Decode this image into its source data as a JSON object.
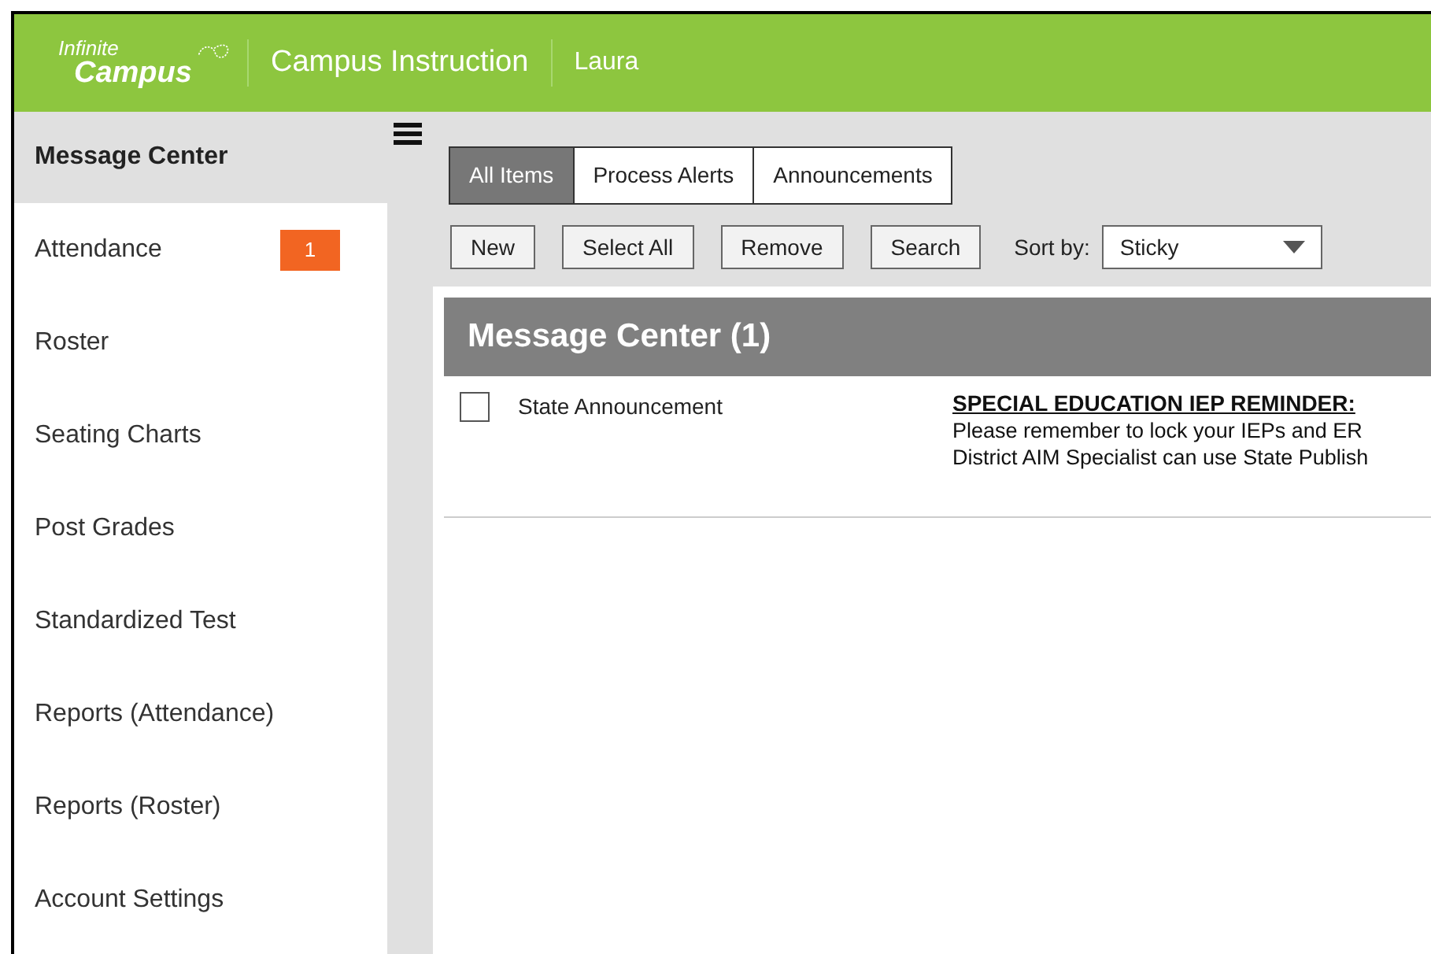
{
  "header": {
    "logo": [
      "Infinite",
      "Campus"
    ],
    "app_title": "Campus Instruction",
    "user": "Laura"
  },
  "sidebar": {
    "title": "Message Center",
    "items": [
      {
        "label": "Attendance",
        "badge": "1"
      },
      {
        "label": "Roster"
      },
      {
        "label": "Seating Charts"
      },
      {
        "label": "Post Grades"
      },
      {
        "label": "Standardized Test"
      },
      {
        "label": "Reports (Attendance)"
      },
      {
        "label": "Reports (Roster)"
      },
      {
        "label": "Account Settings"
      }
    ]
  },
  "tabs": [
    {
      "label": "All Items",
      "selected": true
    },
    {
      "label": "Process Alerts",
      "selected": false
    },
    {
      "label": "Announcements",
      "selected": false
    }
  ],
  "toolbar": {
    "buttons": [
      "New",
      "Select All",
      "Remove",
      "Search"
    ],
    "sort_label": "Sort by:",
    "sort_value": "Sticky"
  },
  "panel": {
    "title": "Message Center (1)",
    "messages": [
      {
        "checked": false,
        "type": "State Announcement",
        "subject": "SPECIAL EDUCATION IEP REMINDER:",
        "lines": [
          "Please remember to lock your IEPs and ER",
          "District AIM Specialist can use State Publish"
        ]
      }
    ]
  }
}
